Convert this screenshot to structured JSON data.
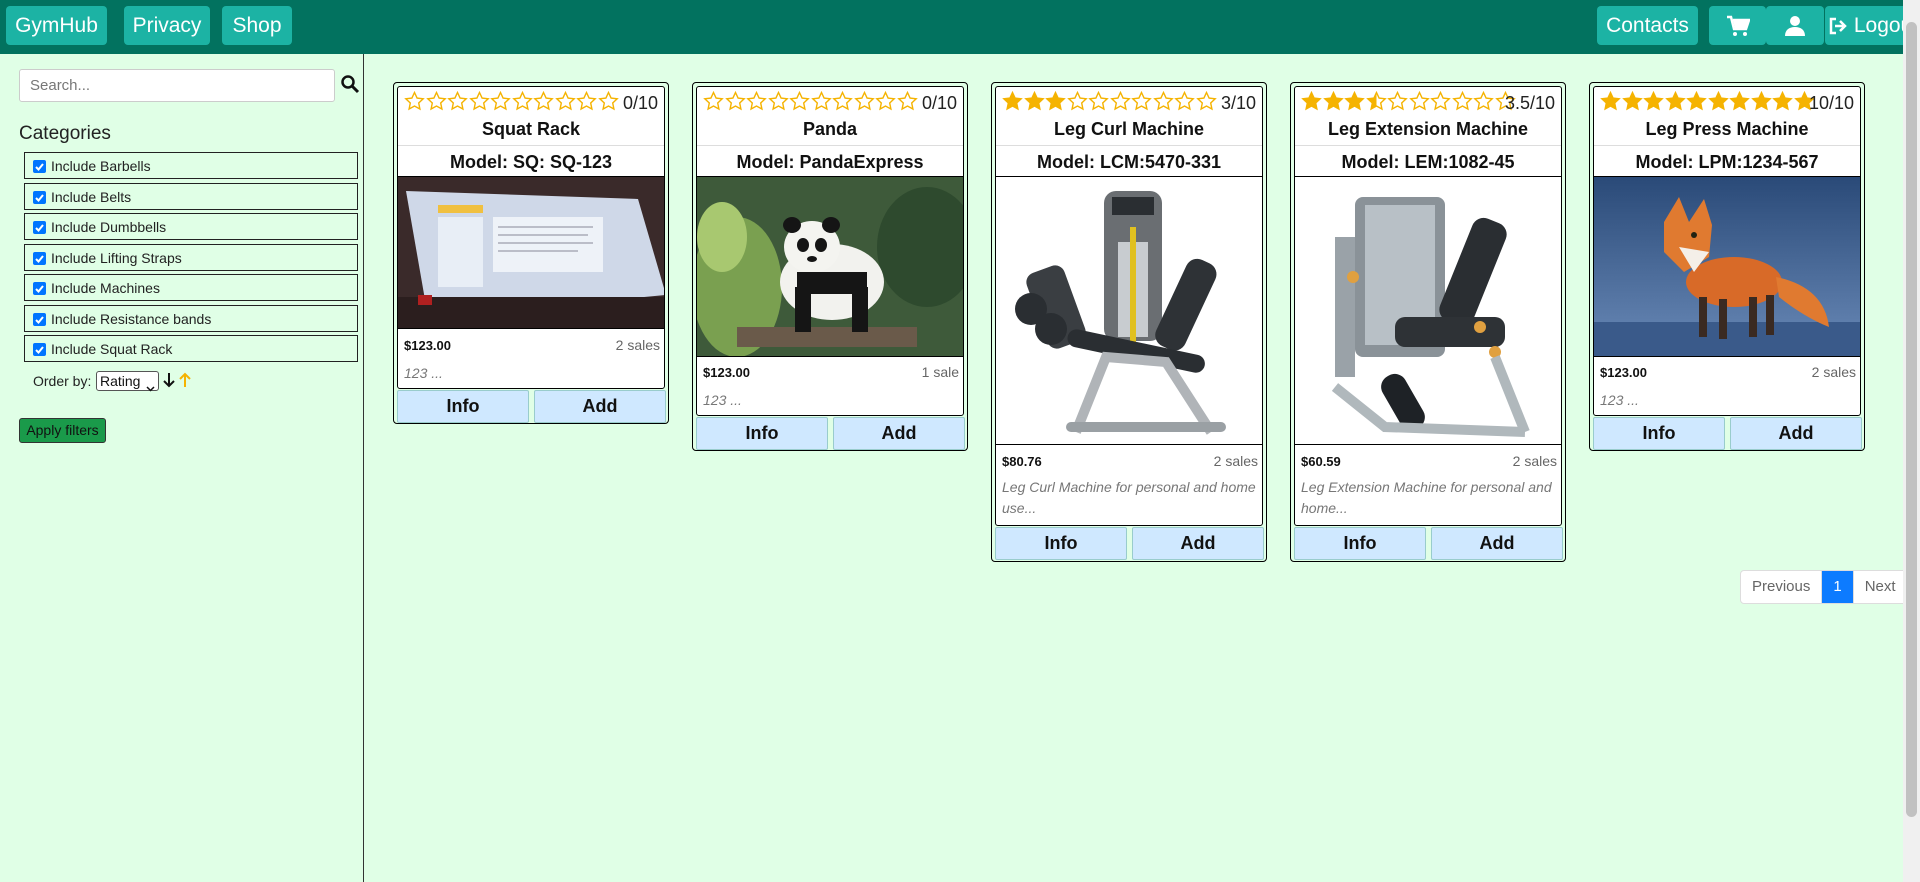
{
  "nav": {
    "brand": "GymHub",
    "privacy": "Privacy",
    "shop": "Shop",
    "contacts": "Contacts",
    "logout": "Logout",
    "icons": [
      "cart-icon",
      "user-icon",
      "logout-icon"
    ]
  },
  "sidebar": {
    "search_placeholder": "Search...",
    "categories_title": "Categories",
    "categories": [
      {
        "label": "Include Barbells",
        "checked": true
      },
      {
        "label": "Include Belts",
        "checked": true
      },
      {
        "label": "Include Dumbbells",
        "checked": true
      },
      {
        "label": "Include Lifting Straps",
        "checked": true
      },
      {
        "label": "Include Machines",
        "checked": true
      },
      {
        "label": "Include Resistance bands",
        "checked": true
      },
      {
        "label": "Include Squat Rack",
        "checked": true
      }
    ],
    "order_label": "Order by:",
    "order_value": "Rating",
    "apply_label": "Apply filters"
  },
  "products": [
    {
      "name": "Squat Rack",
      "model": "Model: SQ: SQ-123",
      "rating": 0,
      "rating_text": "0/10",
      "price": "$123.00",
      "sales": "2 sales",
      "description": "123 ...",
      "info": "Info",
      "add": "Add"
    },
    {
      "name": "Panda",
      "model": "Model: PandaExpress",
      "rating": 0,
      "rating_text": "0/10",
      "price": "$123.00",
      "sales": "1 sale",
      "description": "123 ...",
      "info": "Info",
      "add": "Add"
    },
    {
      "name": "Leg Curl Machine",
      "model": "Model: LCM:5470-331",
      "rating": 3,
      "rating_text": "3/10",
      "price": "$80.76",
      "sales": "2 sales",
      "description": "Leg Curl Machine for personal and home use...",
      "info": "Info",
      "add": "Add"
    },
    {
      "name": "Leg Extension Machine",
      "model": "Model: LEM:1082-45",
      "rating": 3.5,
      "rating_text": "3.5/10",
      "price": "$60.59",
      "sales": "2 sales",
      "description": "Leg Extension Machine for personal and home...",
      "info": "Info",
      "add": "Add"
    },
    {
      "name": "Leg Press Machine",
      "model": "Model: LPM:1234-567",
      "rating": 10,
      "rating_text": "10/10",
      "price": "$123.00",
      "sales": "2 sales",
      "description": "123 ...",
      "info": "Info",
      "add": "Add"
    }
  ],
  "pagination": {
    "previous": "Previous",
    "current": "1",
    "next": "Next"
  },
  "colors": {
    "navbar": "#02725f",
    "nav_button": "#1cb3a4",
    "background": "#e0ffe6",
    "star": "#f5b301",
    "active_page": "#0d7bff",
    "apply_button": "#1a9a4a"
  }
}
